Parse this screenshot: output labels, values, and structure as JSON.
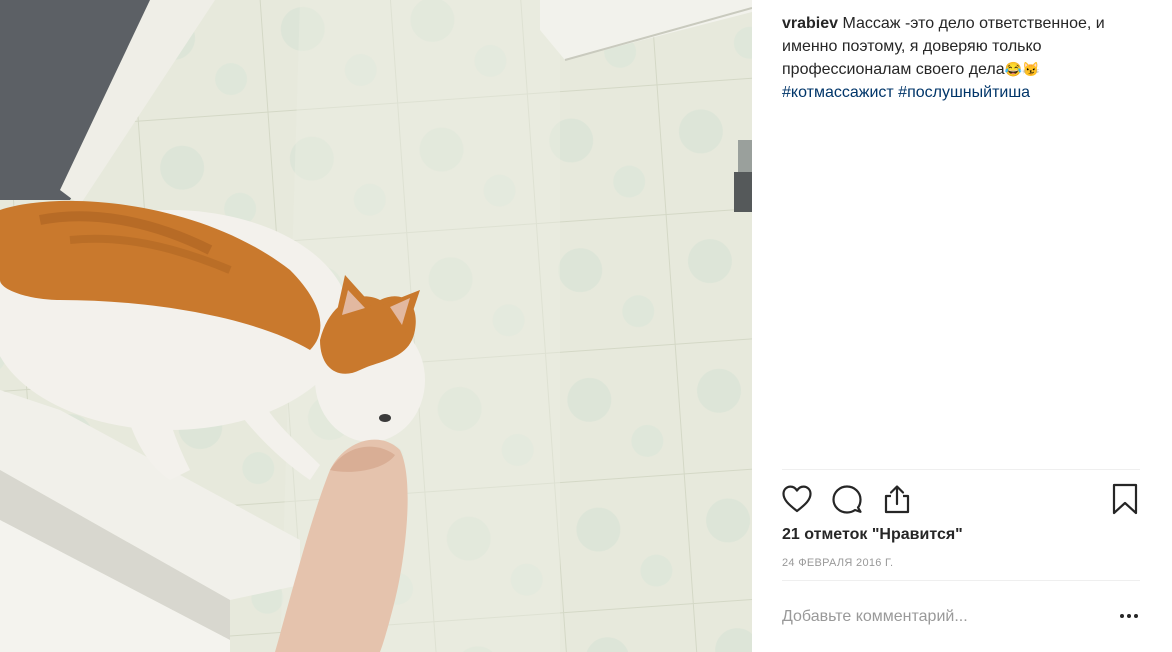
{
  "post": {
    "username": "vrabiev",
    "caption_text": " Массаж -это дело ответственное, и именно поэтому, я доверяю только профессионалам своего дела",
    "caption_emoji": "😂😼",
    "hashtags": [
      "#котмассажист",
      "#послушныйтиша"
    ],
    "likes_text": "21 отметок \"Нравится\"",
    "date_text": "24 ФЕВРАЛЯ 2016 Г.",
    "comment_placeholder": "Добавьте комментарий...",
    "photo_subject": "orange-white-cat-biting-foot-bathroom"
  },
  "icons": {
    "like": "heart-icon",
    "comment": "comment-bubble-icon",
    "share": "share-icon",
    "save": "bookmark-icon",
    "more": "more-options-icon"
  },
  "colors": {
    "text": "#262626",
    "hashtag": "#003569",
    "muted": "#999999",
    "divider": "#efefef"
  }
}
